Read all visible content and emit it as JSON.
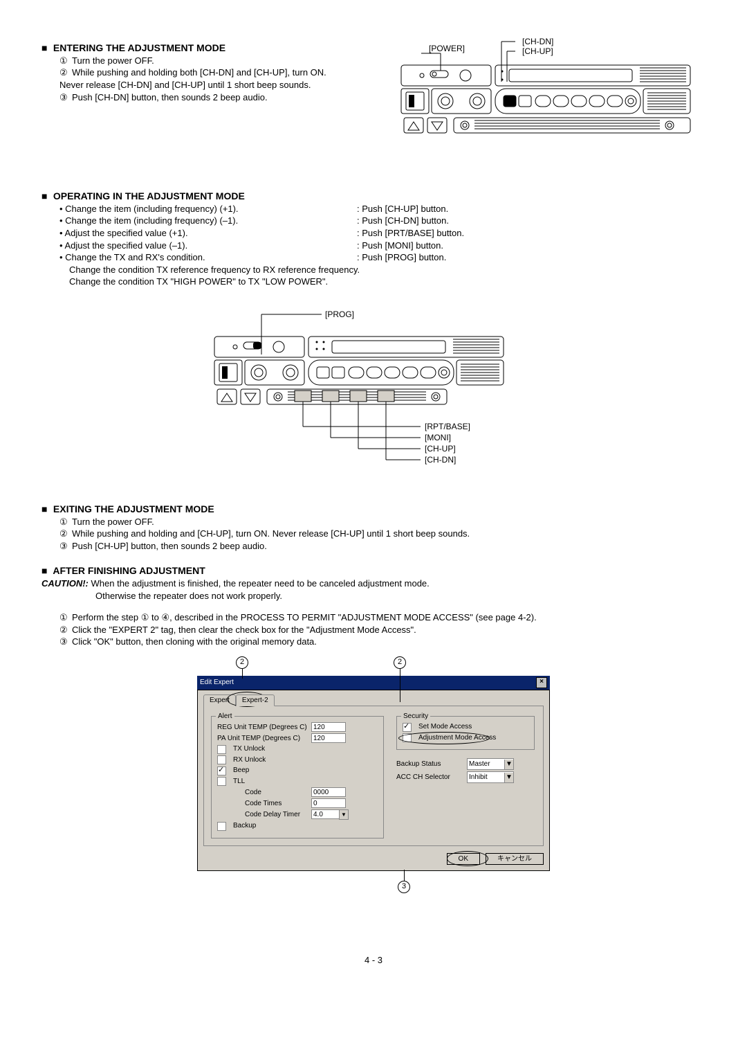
{
  "sections": {
    "entering": {
      "title": "ENTERING THE ADJUSTMENT MODE",
      "steps": [
        "Turn the power OFF.",
        "While pushing and holding both [CH-DN] and [CH-UP], turn ON. Never release [CH-DN] and [CH-UP] until 1 short beep sounds.",
        "Push [CH-DN] button, then sounds 2 beep audio."
      ],
      "labels": {
        "power": "[POWER]",
        "chdn": "[CH-DN]",
        "chup": "[CH-UP]"
      }
    },
    "operating": {
      "title": "OPERATING IN THE ADJUSTMENT MODE",
      "rows": [
        {
          "l": "• Change the item (including frequency) (+1).",
          "r": ": Push [CH-UP] button."
        },
        {
          "l": "• Change the item (including frequency) (–1).",
          "r": ": Push [CH-DN] button."
        },
        {
          "l": "• Adjust the specified value (+1).",
          "r": ": Push [PRT/BASE] button."
        },
        {
          "l": "• Adjust the specified value (–1).",
          "r": ": Push [MONI] button."
        },
        {
          "l": "• Change the TX and RX's condition.",
          "r": ": Push [PROG] button."
        }
      ],
      "sub": [
        "Change the condition TX reference frequency to RX reference frequency.",
        "Change the condition TX \"HIGH POWER\" to TX \"LOW POWER\"."
      ],
      "labels": {
        "prog": "[PROG]",
        "rptbase": "[RPT/BASE]",
        "moni": "[MONI]",
        "chup": "[CH-UP]",
        "chdn": "[CH-DN]"
      }
    },
    "exiting": {
      "title": "EXITING THE ADJUSTMENT MODE",
      "steps": [
        "Turn the power OFF.",
        "While pushing and holding and [CH-UP], turn ON. Never release [CH-UP] until 1 short beep sounds.",
        "Push [CH-UP] button, then sounds 2 beep audio."
      ]
    },
    "after": {
      "title": "AFTER FINISHING ADJUSTMENT",
      "caution_label": "CAUTION!:",
      "caution": [
        "When the adjustment is finished, the repeater need to be canceled adjustment mode.",
        "Otherwise the repeater does not work properly."
      ],
      "steps": [
        "Perform the step ① to ④, described in the PROCESS TO PERMIT \"ADJUSTMENT MODE ACCESS\" (see page 4-2).",
        "Click the \"EXPERT 2\" tag, then clear the check box for the \"Adjustment Mode Access\".",
        "Click \"OK\" button, then cloning with the original memory data."
      ]
    }
  },
  "dialog": {
    "title": "Edit Expert",
    "tabs": {
      "t1": "Expert",
      "t2": "Expert-2"
    },
    "alert_group": "Alert",
    "security_group": "Security",
    "fields": {
      "reg_temp": {
        "label": "REG Unit TEMP (Degrees C)",
        "value": "120"
      },
      "pa_temp": {
        "label": "PA Unit TEMP (Degrees C)",
        "value": "120"
      },
      "tx_unlock": {
        "label": "TX Unlock"
      },
      "rx_unlock": {
        "label": "RX Unlock"
      },
      "beep": {
        "label": "Beep"
      },
      "tll": {
        "label": "TLL"
      },
      "code": {
        "label": "Code",
        "value": "0000"
      },
      "code_times": {
        "label": "Code Times",
        "value": "0"
      },
      "code_delay": {
        "label": "Code Delay Timer",
        "value": "4.0"
      },
      "backup": {
        "label": "Backup"
      },
      "set_mode": {
        "label": "Set Mode Access"
      },
      "adj_mode": {
        "label": "Adjustment Mode Access"
      },
      "backup_status": {
        "label": "Backup Status",
        "value": "Master"
      },
      "acc_ch": {
        "label": "ACC CH Selector",
        "value": "Inhibit"
      }
    },
    "buttons": {
      "ok": "OK",
      "cancel": "キャンセル"
    },
    "callouts": {
      "c2": "2",
      "c3": "3"
    }
  },
  "pagenum": "4 - 3",
  "nums": {
    "n1": "①",
    "n2": "②",
    "n3": "③"
  }
}
